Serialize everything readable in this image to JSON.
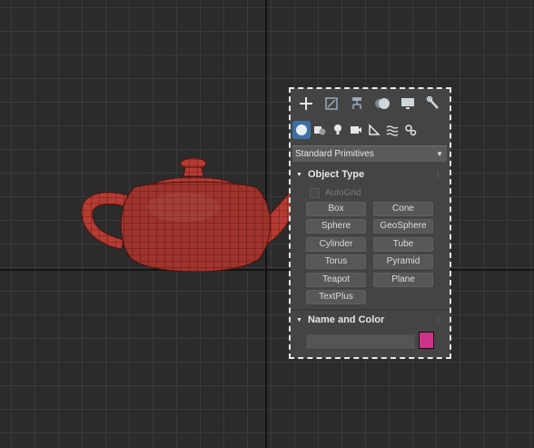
{
  "tabs": [
    {
      "icon": "create-plus-icon"
    },
    {
      "icon": "modify-icon"
    },
    {
      "icon": "hierarchy-icon"
    },
    {
      "icon": "motion-icon"
    },
    {
      "icon": "display-icon"
    },
    {
      "icon": "utilities-wrench-icon"
    }
  ],
  "subtabs": [
    {
      "icon": "geometry-sphere-icon",
      "active": true
    },
    {
      "icon": "shapes-icon"
    },
    {
      "icon": "lights-icon"
    },
    {
      "icon": "cameras-icon"
    },
    {
      "icon": "helpers-icon"
    },
    {
      "icon": "space-warps-icon"
    },
    {
      "icon": "systems-icon"
    }
  ],
  "category": {
    "selected": "Standard Primitives"
  },
  "object_type": {
    "title": "Object Type",
    "autogrid_label": "AutoGrid",
    "buttons": [
      "Box",
      "Cone",
      "Sphere",
      "GeoSphere",
      "Cylinder",
      "Tube",
      "Torus",
      "Pyramid",
      "Teapot",
      "Plane",
      "TextPlus"
    ]
  },
  "name_and_color": {
    "title": "Name and Color",
    "name_value": "",
    "color": "#cc3388"
  },
  "colors": {
    "accent": "#3d6fa3",
    "teapot": "#b83a32"
  }
}
